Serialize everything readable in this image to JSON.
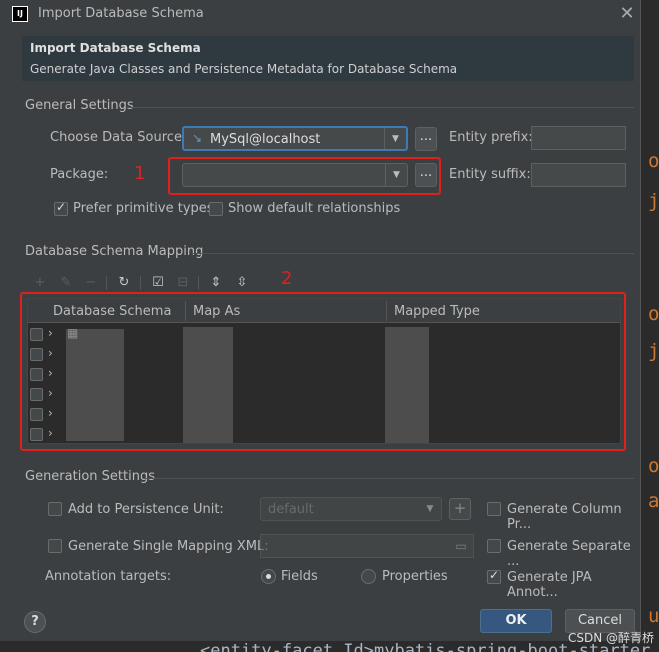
{
  "dialog": {
    "title": "Import Database Schema",
    "header_title": "Import Database Schema",
    "header_desc": "Generate Java Classes and Persistence Metadata for Database Schema"
  },
  "general": {
    "section": "General Settings",
    "data_source_label": "Choose Data Source:",
    "data_source_value": "MySql@localhost",
    "package_label": "Package:",
    "package_value": "",
    "entity_prefix_label": "Entity prefix:",
    "entity_suffix_label": "Entity suffix:",
    "prefer_primitive_label": "Prefer primitive types",
    "prefer_primitive_checked": true,
    "show_default_rel_label": "Show default relationships",
    "show_default_rel_checked": false,
    "ellipsis": "..."
  },
  "mapping": {
    "section": "Database Schema Mapping",
    "columns": [
      "Database Schema",
      "Map As",
      "Mapped Type"
    ],
    "row_count": 6
  },
  "annotations": {
    "label_1": "1",
    "label_2": "2"
  },
  "generation": {
    "section": "Generation Settings",
    "add_persistence_label": "Add to Persistence Unit:",
    "persistence_value": "default",
    "single_mapping_label": "Generate Single Mapping XML:",
    "annotation_targets_label": "Annotation targets:",
    "fields_label": "Fields",
    "properties_label": "Properties",
    "gen_column_label": "Generate Column Pr...",
    "gen_separate_label": "Generate Separate ...",
    "gen_jpa_label": "Generate JPA Annot..."
  },
  "buttons": {
    "ok": "OK",
    "cancel": "Cancel",
    "help": "?",
    "add": "+"
  },
  "icons": {
    "close": "close-icon",
    "refresh": "refresh-icon",
    "database": "database-icon"
  },
  "editor": {
    "bottom_code": "<entity-facet Id>mybatis-spring-boot-starter"
  },
  "watermark": "CSDN @醉青桥"
}
